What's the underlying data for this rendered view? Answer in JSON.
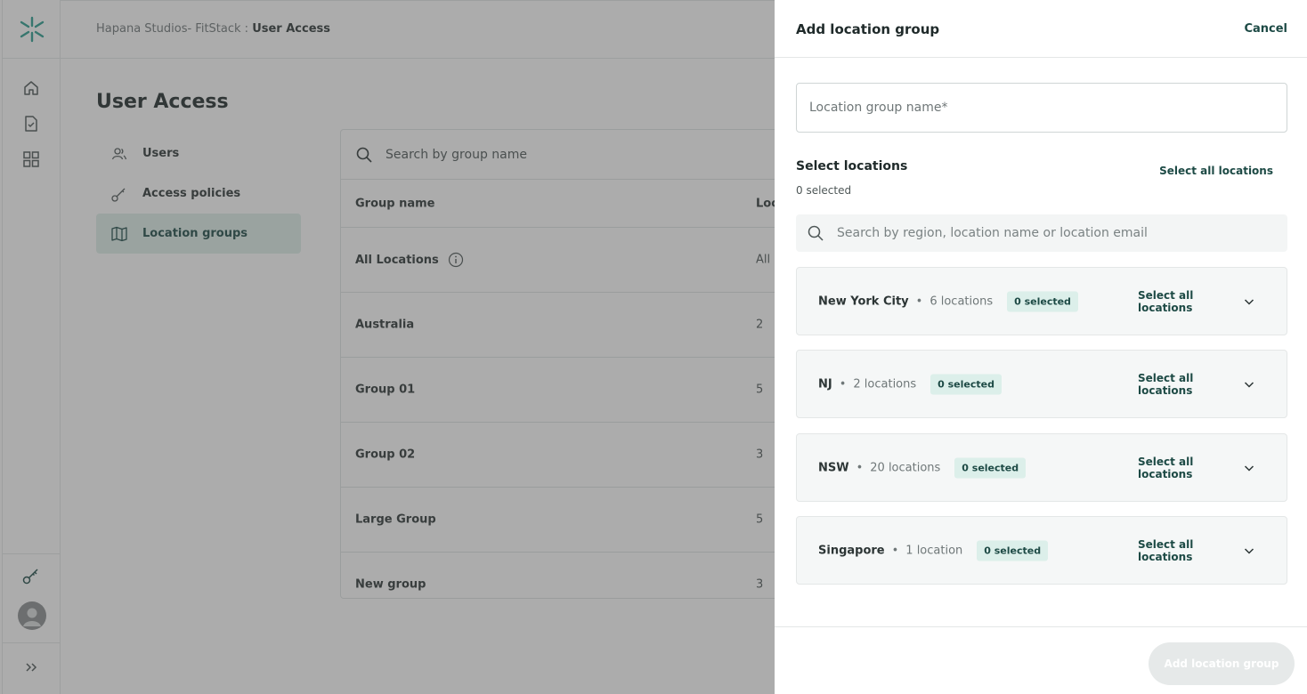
{
  "colors": {
    "brand": "#2a9d8f",
    "accent": "#1d4a45",
    "active_nav_bg": "#deeeea",
    "badge_bg": "#dcefea"
  },
  "header": {
    "breadcrumb_org": "Hapana Studios- FitStack :",
    "breadcrumb_page": "User Access"
  },
  "page": {
    "title": "User Access"
  },
  "nav": {
    "items": [
      {
        "label": "Users",
        "icon": "users-icon"
      },
      {
        "label": "Access policies",
        "icon": "key-icon"
      },
      {
        "label": "Location groups",
        "icon": "map-icon"
      }
    ]
  },
  "table": {
    "search_placeholder": "Search by group name",
    "columns": [
      "Group name",
      "Loc"
    ],
    "rows": [
      {
        "name": "All Locations",
        "count": "All"
      },
      {
        "name": "Australia",
        "count": "2"
      },
      {
        "name": "Group 01",
        "count": "5"
      },
      {
        "name": "Group 02",
        "count": "3"
      },
      {
        "name": "Large Group",
        "count": "5"
      },
      {
        "name": "New group",
        "count": "3"
      }
    ]
  },
  "drawer": {
    "title": "Add location group",
    "cancel_label": "Cancel",
    "name_placeholder": "Location group name*",
    "select_title": "Select locations",
    "selected_count": "0 selected",
    "select_all_label": "Select all locations",
    "search_placeholder": "Search by region, location name or location email",
    "regions": [
      {
        "name": "New York City",
        "count": "6 locations",
        "badge": "0 selected",
        "select_all": "Select all locations"
      },
      {
        "name": "NJ",
        "count": "2 locations",
        "badge": "0 selected",
        "select_all": "Select all locations"
      },
      {
        "name": "NSW",
        "count": "20 locations",
        "badge": "0 selected",
        "select_all": "Select all locations"
      },
      {
        "name": "Singapore",
        "count": "1 location",
        "badge": "0 selected",
        "select_all": "Select all locations"
      }
    ],
    "submit_label": "Add location group"
  }
}
